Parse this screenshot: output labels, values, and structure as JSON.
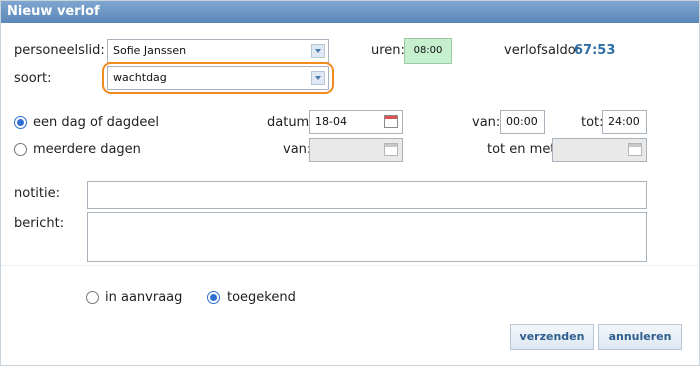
{
  "dialog": {
    "title": "Nieuw verlof"
  },
  "employee": {
    "label": "personeelslid:",
    "value": "Sofie Janssen"
  },
  "hours": {
    "label": "uren:",
    "value": "08:00",
    "color": "#c6efce"
  },
  "balance": {
    "label": "verlofsaldo:",
    "value": "67:53",
    "color": "#2e6da4"
  },
  "type": {
    "label": "soort:",
    "value": "wachtdag",
    "highlight_color": "#f28a1d"
  },
  "single_day": {
    "radio_label": "een dag of dagdeel",
    "selected": true,
    "date_label": "datum:",
    "date_value": "18-04",
    "from_label": "van:",
    "from_value": "00:00",
    "to_label": "tot:",
    "to_value": "24:00"
  },
  "multi_day": {
    "radio_label": "meerdere dagen",
    "selected": false,
    "from_label": "van:",
    "from_value": "",
    "until_label": "tot en met:",
    "until_value": ""
  },
  "note": {
    "label": "notitie:",
    "value": ""
  },
  "message": {
    "label": "bericht:",
    "value": ""
  },
  "status": {
    "options": [
      {
        "label": "in aanvraag",
        "selected": false
      },
      {
        "label": "toegekend",
        "selected": true
      }
    ]
  },
  "buttons": {
    "send": "verzenden",
    "cancel": "annuleren"
  },
  "icons": {
    "dropdown": "chevron-down-icon",
    "calendar": "calendar-icon",
    "accent": "#2d6fd2"
  }
}
